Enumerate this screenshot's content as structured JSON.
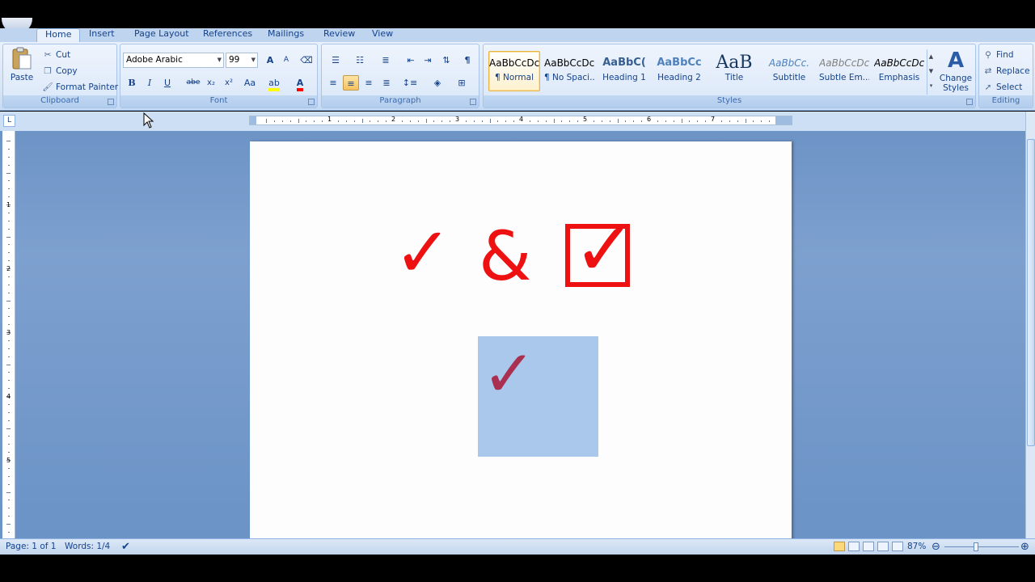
{
  "tabs": [
    "Home",
    "Insert",
    "Page Layout",
    "References",
    "Mailings",
    "Review",
    "View"
  ],
  "clipboard": {
    "label": "Clipboard",
    "paste": "Paste",
    "cut": "Cut",
    "copy": "Copy",
    "format_painter": "Format Painter"
  },
  "font": {
    "label": "Font",
    "name": "Adobe Arabic",
    "size": "99",
    "grow": "A",
    "shrink": "A",
    "bold": "B",
    "italic": "I",
    "underline": "U",
    "strike": "abe",
    "subscript": "x₂",
    "superscript": "x²",
    "case": "Aa",
    "highlight_color": "#ffff00",
    "font_color": "#ff0000"
  },
  "paragraph": {
    "label": "Paragraph"
  },
  "styles": {
    "label": "Styles",
    "items": [
      {
        "preview": "AaBbCcDc",
        "name": "¶ Normal"
      },
      {
        "preview": "AaBbCcDc",
        "name": "¶ No Spaci..."
      },
      {
        "preview": "AaBbC(",
        "name": "Heading 1"
      },
      {
        "preview": "AaBbCc",
        "name": "Heading 2"
      },
      {
        "preview": "AaB",
        "name": "Title"
      },
      {
        "preview": "AaBbCc.",
        "name": "Subtitle"
      },
      {
        "preview": "AaBbCcDc",
        "name": "Subtle Em..."
      },
      {
        "preview": "AaBbCcDc",
        "name": "Emphasis"
      }
    ],
    "change_styles": "Change Styles"
  },
  "editing": {
    "label": "Editing",
    "find": "Find",
    "replace": "Replace",
    "select": "Select"
  },
  "ruler_numbers": [
    "1",
    "2",
    "3",
    "4",
    "5",
    "6",
    "7"
  ],
  "vruler_numbers": [
    "1",
    "2",
    "3",
    "4",
    "5"
  ],
  "document": {
    "check": "✓",
    "ampersand": "&",
    "checkbox": "☑",
    "selected_check": "✓",
    "symbol_color": "#ee1111",
    "selected_check_color": "#a93050"
  },
  "status": {
    "page": "Page: 1 of 1",
    "words": "Words: 1/4",
    "zoom": "87%"
  }
}
